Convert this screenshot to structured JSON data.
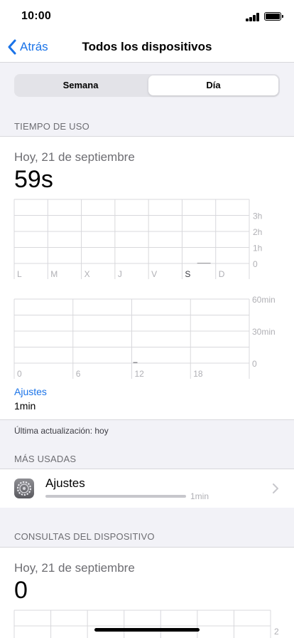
{
  "status_bar": {
    "time": "10:00"
  },
  "nav": {
    "back_label": "Atrás",
    "title": "Todos los dispositivos"
  },
  "segmented": {
    "week_label": "Semana",
    "day_label": "Día",
    "selected": "Día"
  },
  "screen_time": {
    "header": "TIEMPO DE USO",
    "date": "Hoy, 21 de septiembre",
    "total": "59s",
    "top_app_name": "Ajustes",
    "top_app_time": "1min",
    "updated": "Última actualización: hoy"
  },
  "weekly_chart": {
    "days": [
      "L",
      "M",
      "X",
      "J",
      "V",
      "S",
      "D"
    ],
    "y_labels": [
      "3h",
      "2h",
      "1h",
      "0"
    ],
    "highlight_day": "S"
  },
  "hourly_chart": {
    "x_labels": [
      "0",
      "6",
      "12",
      "18"
    ],
    "y_labels": [
      "60min",
      "30min",
      "0"
    ]
  },
  "chart_data": [
    {
      "type": "bar",
      "categories": [
        "L",
        "M",
        "X",
        "J",
        "V",
        "S",
        "D"
      ],
      "values": [
        0,
        0,
        0,
        0,
        0,
        0.016,
        0
      ],
      "unit": "h",
      "ylim": [
        0,
        3
      ],
      "y_ticks": [
        "0",
        "1h",
        "2h",
        "3h"
      ]
    },
    {
      "type": "bar",
      "x_ticks": [
        "0",
        "6",
        "12",
        "18"
      ],
      "hours": [
        12
      ],
      "values": [
        1
      ],
      "unit": "min",
      "ylim": [
        0,
        60
      ],
      "y_ticks": [
        "0",
        "30min",
        "60min"
      ]
    }
  ],
  "most_used": {
    "header": "MÁS USADAS",
    "items": [
      {
        "name": "Ajustes",
        "time": "1min",
        "icon": "settings-gear-icon"
      }
    ]
  },
  "pickups": {
    "header": "CONSULTAS DEL DISPOSITIVO",
    "date": "Hoy, 21 de septiembre",
    "total": "0",
    "y_label_top": "2"
  },
  "colors": {
    "accent": "#1a73e8",
    "background": "#f2f2f7",
    "grid": "#d8d8dc"
  }
}
